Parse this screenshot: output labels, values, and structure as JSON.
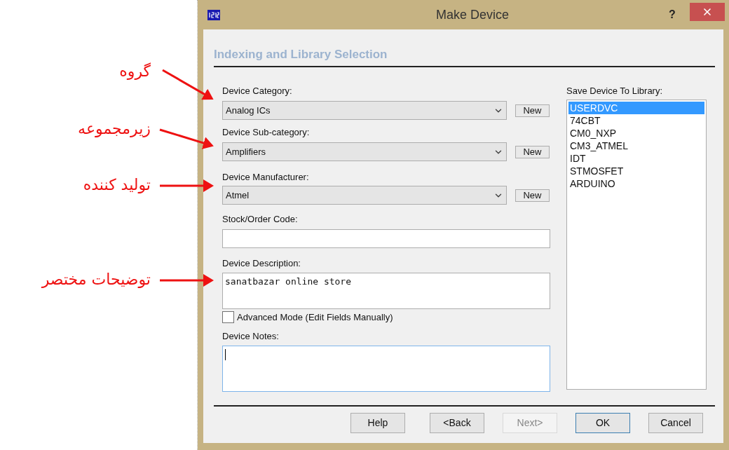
{
  "window": {
    "title": "Make Device",
    "help_label": "?"
  },
  "section_title": "Indexing and Library Selection",
  "fields": [
    {
      "kind": "combo",
      "label": "Device Category:",
      "value": "Analog ICs",
      "button": "New"
    },
    {
      "kind": "combo",
      "label": "Device Sub-category:",
      "value": "Amplifiers",
      "button": "New"
    },
    {
      "kind": "combo",
      "label": "Device Manufacturer:",
      "value": "Atmel",
      "button": "New"
    },
    {
      "kind": "text",
      "label": "Stock/Order Code:",
      "focused": false
    },
    {
      "kind": "textarea",
      "label": "Device Description:",
      "value": "sanatbazar online store",
      "focused": false
    },
    {
      "kind": "checkbox",
      "label": "Advanced Mode (Edit Fields Manually)",
      "checked": false
    },
    {
      "kind": "textarea",
      "label": "Device Notes:",
      "focused": true
    }
  ],
  "library": {
    "label": "Save Device To Library:",
    "items": [
      {
        "name": "USERDVC",
        "selected": true
      },
      {
        "name": "74CBT",
        "selected": false
      },
      {
        "name": "CM0_NXP",
        "selected": false
      },
      {
        "name": "CM3_ATMEL",
        "selected": false
      },
      {
        "name": "IDT",
        "selected": false
      },
      {
        "name": "STMOSFET",
        "selected": false
      },
      {
        "name": "ARDUINO",
        "selected": false
      }
    ]
  },
  "buttons": [
    {
      "label": "Help",
      "disabled": false,
      "default": false
    },
    {
      "label": "<Back",
      "disabled": false,
      "default": false
    },
    {
      "label": "Next>",
      "disabled": true,
      "default": false
    },
    {
      "label": "OK",
      "disabled": false,
      "default": true
    },
    {
      "label": "Cancel",
      "disabled": false,
      "default": false
    }
  ],
  "annotations": [
    {
      "text": "گروه"
    },
    {
      "text": "زیرمجموعه"
    },
    {
      "text": "تولید کننده"
    },
    {
      "text": "توضیحات مختصر"
    }
  ]
}
